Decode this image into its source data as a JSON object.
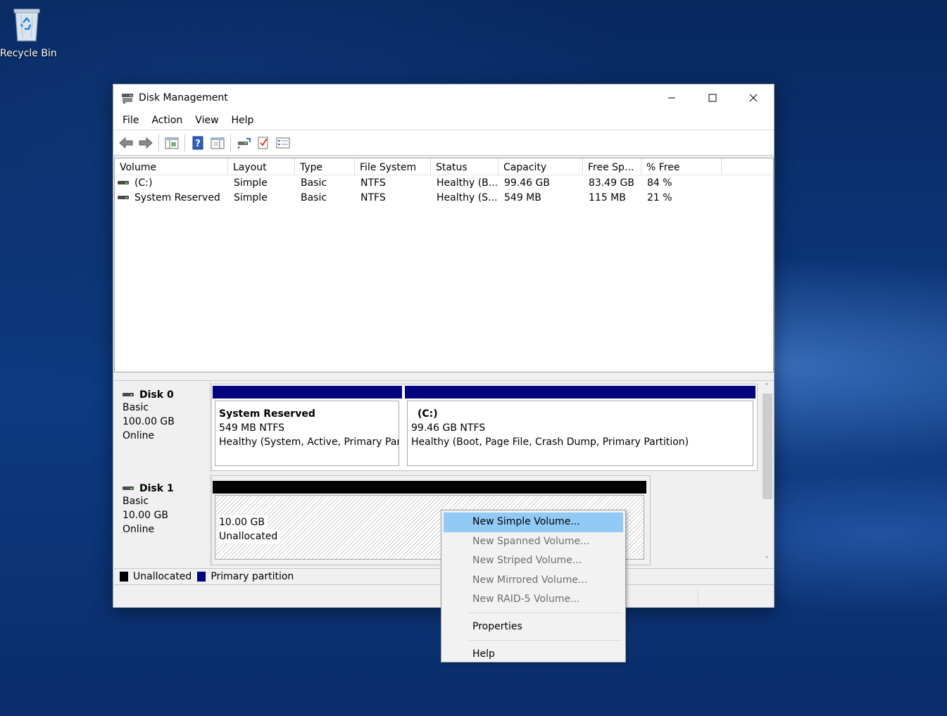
{
  "desktop": {
    "recycle_bin_label": "Recycle Bin"
  },
  "window": {
    "title": "Disk Management",
    "menu": [
      "File",
      "Action",
      "View",
      "Help"
    ]
  },
  "volume_list": {
    "columns": [
      "Volume",
      "Layout",
      "Type",
      "File System",
      "Status",
      "Capacity",
      "Free Sp...",
      "% Free"
    ],
    "rows": [
      {
        "volume": "(C:)",
        "layout": "Simple",
        "type": "Basic",
        "fs": "NTFS",
        "status": "Healthy (B...",
        "capacity": "99.46 GB",
        "free": "83.49 GB",
        "pct": "84 %"
      },
      {
        "volume": "System Reserved",
        "layout": "Simple",
        "type": "Basic",
        "fs": "NTFS",
        "status": "Healthy (S...",
        "capacity": "549 MB",
        "free": "115 MB",
        "pct": "21 %"
      }
    ]
  },
  "disks": [
    {
      "name": "Disk 0",
      "kind": "Basic",
      "size": "100.00 GB",
      "state": "Online",
      "partitions": [
        {
          "title": "System Reserved",
          "size_fs": "549 MB NTFS",
          "status": "Healthy (System, Active, Primary Partit"
        },
        {
          "title": "(C:)",
          "size_fs": "99.46 GB NTFS",
          "status": "Healthy (Boot, Page File, Crash Dump, Primary Partition)"
        }
      ]
    },
    {
      "name": "Disk 1",
      "kind": "Basic",
      "size": "10.00 GB",
      "state": "Online",
      "partitions": [
        {
          "size": "10.00 GB",
          "label": "Unallocated"
        }
      ]
    }
  ],
  "legend": {
    "unallocated": "Unallocated",
    "primary": "Primary partition",
    "unallocated_color": "#000000",
    "primary_color": "#00007f"
  },
  "context_menu": {
    "items": [
      {
        "label": "New Simple Volume...",
        "state": "highlighted"
      },
      {
        "label": "New Spanned Volume...",
        "state": "disabled"
      },
      {
        "label": "New Striped Volume...",
        "state": "disabled"
      },
      {
        "label": "New Mirrored Volume...",
        "state": "disabled"
      },
      {
        "label": "New RAID-5 Volume...",
        "state": "disabled"
      },
      {
        "label": "Properties",
        "state": "enabled"
      },
      {
        "label": "Help",
        "state": "enabled"
      }
    ]
  },
  "colors": {
    "primary_bar": "#00007f",
    "unallocated_bar": "#000000",
    "menu_highlight": "#91c9f7"
  }
}
